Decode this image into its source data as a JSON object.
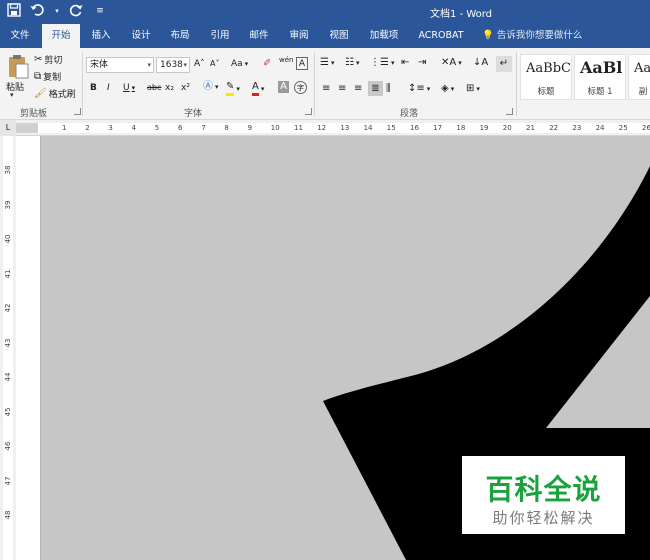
{
  "window": {
    "title": "文档1  -  Word"
  },
  "tabs": [
    "文件",
    "开始",
    "插入",
    "设计",
    "布局",
    "引用",
    "邮件",
    "审阅",
    "视图",
    "加载项",
    "ACROBAT"
  ],
  "tell_me": "告诉我你想要做什么",
  "clipboard": {
    "paste": "粘贴",
    "cut": "剪切",
    "copy": "复制",
    "format_painter": "格式刷",
    "label": "剪贴板"
  },
  "font": {
    "name": "宋体",
    "size": "1638",
    "label": "字体",
    "bold": "B",
    "italic": "I",
    "underline": "U",
    "strike": "abc",
    "sub": "x₂",
    "sup": "x²",
    "grow": "A˄",
    "shrink": "A˅",
    "case": "Aa",
    "wen": "wén",
    "border_a": "A",
    "circle_char": "字"
  },
  "paragraph": {
    "label": "段落"
  },
  "styles": [
    {
      "sample": "AaBbC",
      "name": "标题"
    },
    {
      "sample": "AaBl",
      "name": "标题 1"
    },
    {
      "sample": "Aa",
      "name": "副"
    }
  ],
  "ruler": {
    "h": [
      "1",
      "2",
      "3",
      "4",
      "5",
      "6",
      "7",
      "8",
      "9",
      "10",
      "11",
      "12",
      "13",
      "14",
      "15",
      "16",
      "17",
      "18",
      "19",
      "20",
      "21",
      "22",
      "23",
      "24",
      "25",
      "26"
    ],
    "v": [
      "38",
      "39",
      "40",
      "41",
      "42",
      "43",
      "44",
      "45",
      "46",
      "47",
      "48"
    ]
  },
  "watermark": {
    "title": "百科全说",
    "subtitle": "助你轻松解决"
  },
  "colors": {
    "brand": "#2b579a",
    "watermark_green": "#1aa33c"
  },
  "icons": [
    "save-icon",
    "undo-icon",
    "redo-icon",
    "customize-qat-icon",
    "lightbulb-icon"
  ]
}
